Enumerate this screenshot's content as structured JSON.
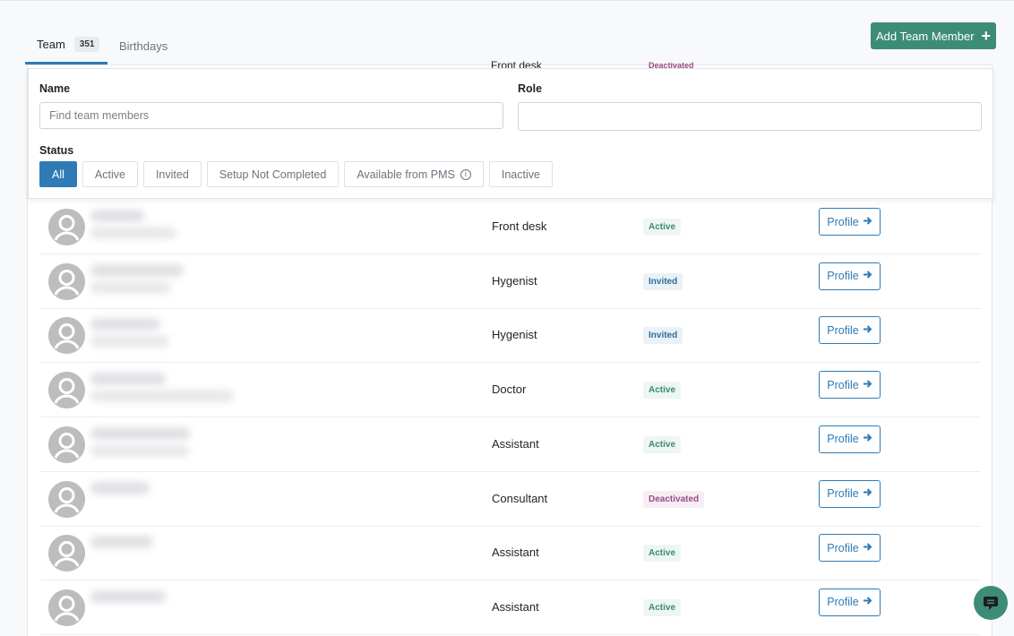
{
  "tabs": [
    {
      "label": "Team",
      "count": "351"
    },
    {
      "label": "Birthdays"
    }
  ],
  "add_button": {
    "label": "Add Team Member",
    "icon": "plus-icon"
  },
  "filters": {
    "name_label": "Name",
    "name_placeholder": "Find team members",
    "role_label": "Role",
    "role_value": "",
    "status_label": "Status",
    "status_options": [
      "All",
      "Active",
      "Invited",
      "Setup Not Completed",
      "Available from PMS",
      "Inactive"
    ],
    "selected_status": "All"
  },
  "peek_row": {
    "role": "Front desk",
    "status": "Deactivated"
  },
  "members": [
    {
      "role": "Front desk",
      "status": "Active",
      "status_type": "active",
      "profile_label": "Profile"
    },
    {
      "role": "Hygenist",
      "status": "Invited",
      "status_type": "invited",
      "profile_label": "Profile"
    },
    {
      "role": "Hygenist",
      "status": "Invited",
      "status_type": "invited",
      "profile_label": "Profile"
    },
    {
      "role": "Doctor",
      "status": "Active",
      "status_type": "active",
      "profile_label": "Profile"
    },
    {
      "role": "Assistant",
      "status": "Active",
      "status_type": "active",
      "profile_label": "Profile"
    },
    {
      "role": "Consultant",
      "status": "Deactivated",
      "status_type": "deactivated",
      "profile_label": "Profile"
    },
    {
      "role": "Assistant",
      "status": "Active",
      "status_type": "active",
      "profile_label": "Profile"
    },
    {
      "role": "Assistant",
      "status": "Active",
      "status_type": "active",
      "profile_label": "Profile"
    }
  ],
  "colors": {
    "primary": "#2f7bb6",
    "accent_green": "#3c8c78"
  }
}
